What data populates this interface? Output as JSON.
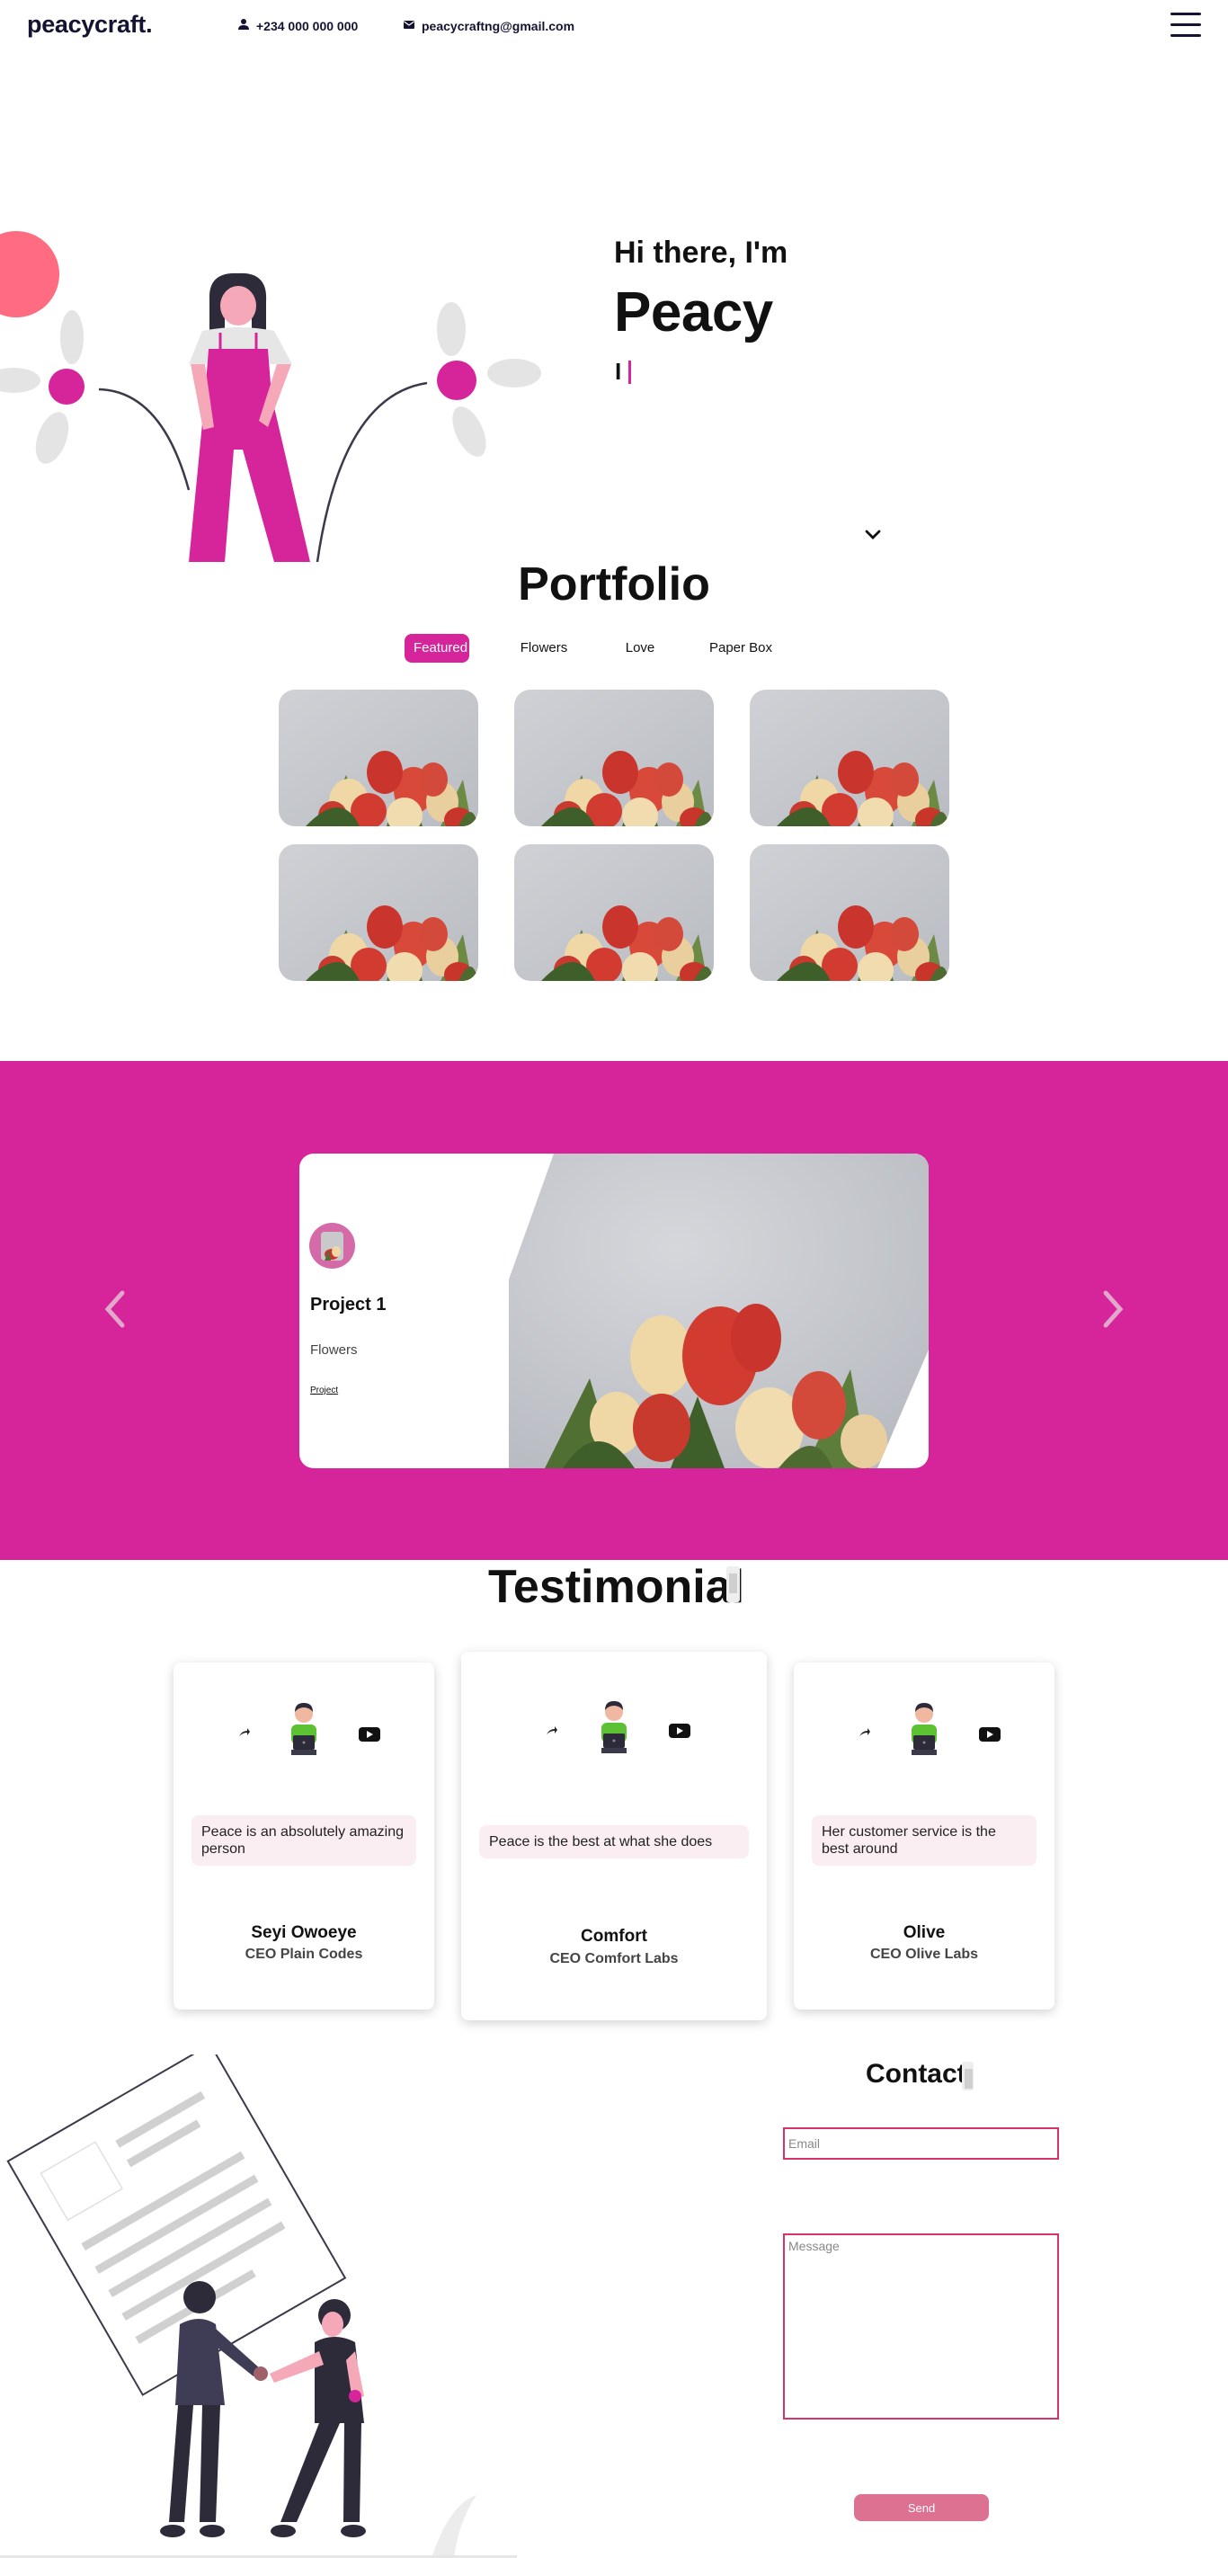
{
  "nav": {
    "brand": "peacycraft.",
    "phone": "+234 000 000 000",
    "email": "peacycraftng@gmail.com"
  },
  "hero": {
    "greeting": "Hi there, I'm",
    "name": "Peacy",
    "typing": "I"
  },
  "portfolio": {
    "title": "Portfolio",
    "filters": [
      "Featured",
      "Flowers",
      "Love",
      "Paper Box"
    ],
    "active_filter": "Featured"
  },
  "project": {
    "title": "Project 1",
    "category": "Flowers",
    "link": "Project"
  },
  "testimonial": {
    "title": "Testimonial",
    "cards": [
      {
        "quote": "Peace is an absolutely amazing person",
        "name": "Seyi Owoeye",
        "role": "CEO Plain Codes"
      },
      {
        "quote": "Peace is the best at what she does",
        "name": "Comfort",
        "role": "CEO Comfort Labs"
      },
      {
        "quote": "Her customer service is the best around",
        "name": "Olive",
        "role": "CEO Olive Labs"
      }
    ]
  },
  "contact": {
    "title": "Contact",
    "email_placeholder": "Email",
    "message_placeholder": "Message",
    "send_label": "Send"
  },
  "colors": {
    "accent": "#d6249b",
    "navy": "#141332",
    "coral": "#ff6b81",
    "send": "#dc7192"
  }
}
